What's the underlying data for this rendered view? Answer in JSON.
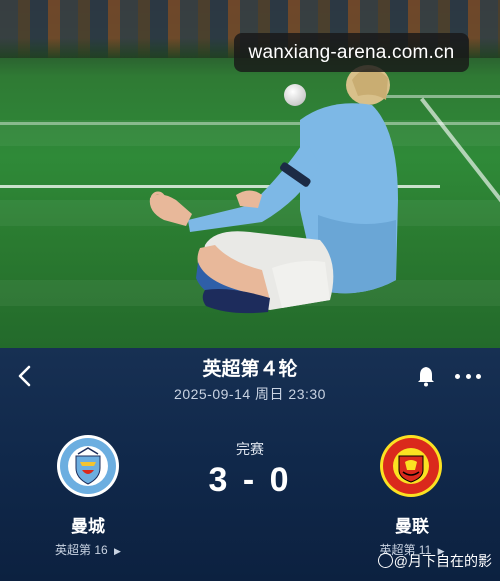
{
  "watermark": {
    "text": "wanxiang-arena.com.cn"
  },
  "match": {
    "title": "英超第４轮",
    "datetime": "2025-09-14  周日 23:30",
    "status": "完赛",
    "score": "3 - 0"
  },
  "home": {
    "name": "曼城",
    "rank": "英超第 16",
    "crest_text": "MANCHESTER CITY"
  },
  "away": {
    "name": "曼联",
    "rank": "英超第 11",
    "crest_text": "MANCHESTER UNITED"
  },
  "credit": {
    "text": "@月下自在的影"
  },
  "icons": {
    "back": "chevron-left-icon",
    "bell": "bell-icon",
    "more": "more-dots-icon",
    "rank_arrow": "caret-right-icon"
  },
  "colors": {
    "panel": "#10284a",
    "city_blue": "#6caee0",
    "united_red": "#da291c",
    "united_gold": "#fbe122"
  }
}
